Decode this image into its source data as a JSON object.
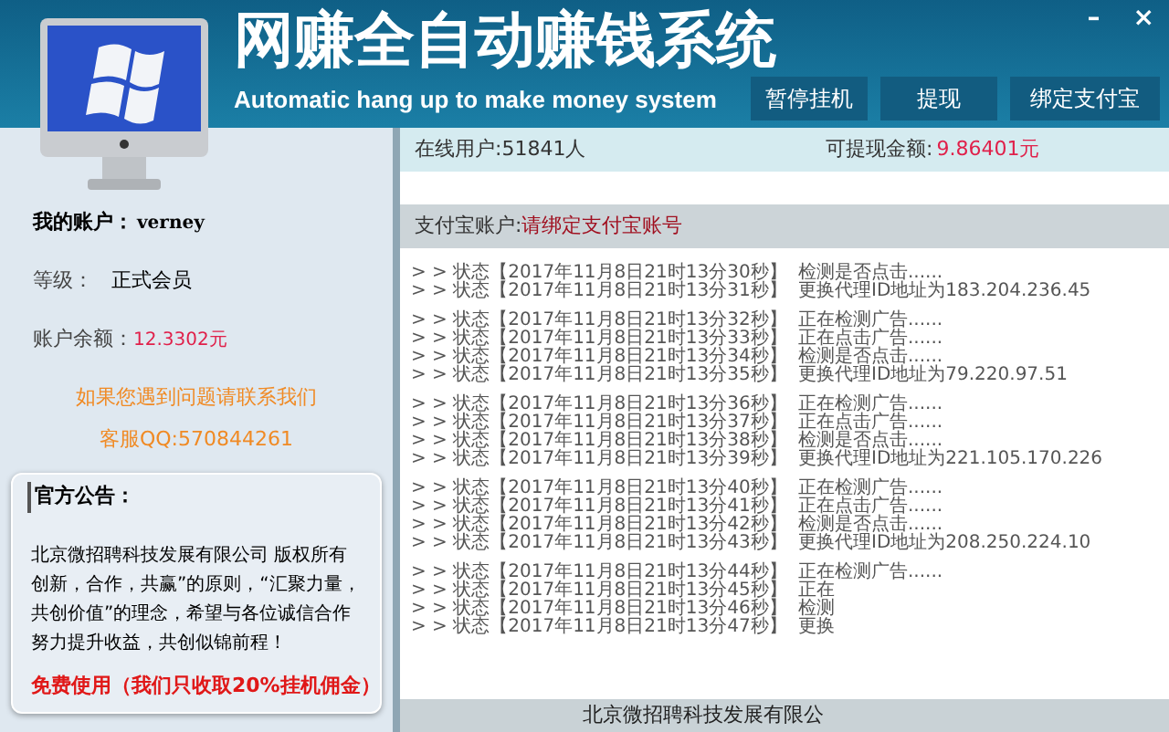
{
  "window": {
    "title": "网赚全自动赚钱系统",
    "subtitle": "Automatic hang up to make money system",
    "controls": [
      "–",
      "×"
    ]
  },
  "toolbar": {
    "buttons": [
      "暂停挂机",
      "提现",
      "绑定支付宝"
    ]
  },
  "account": {
    "username_label": "我的账户：",
    "username": "verney",
    "level_label": "等级：",
    "level": "正式会员",
    "balance_label": "账户余额：",
    "balance": "12.3302元",
    "contact": [
      "如果您遇到问题请联系我们",
      "客服QQ:570844261"
    ]
  },
  "notice": {
    "title": "官方公告：",
    "lines": [
      "北京微招聘科技发展有限公司 版权所有",
      "创新，合作，共赢”的原则，“汇聚力量，",
      "共创价值”的理念，希望与各位诚信合作",
      "努力提升收益，共创似锦前程！"
    ],
    "highlight": "免费使用（我们只收取20%挂机佣金）"
  },
  "stats": {
    "online_label": "在线用户:",
    "online": "51841人",
    "withdrawable_label": "可提现金额:",
    "withdrawable": "9.86401元"
  },
  "alipay": {
    "label": "支付宝账户:",
    "value": "请绑定支付宝账号"
  },
  "log_groups": [
    [
      {
        "prefix": "> > 状态【2017年11月8日21时13分30秒】",
        "message": "检测是否点击......"
      },
      {
        "prefix": "> > 状态【2017年11月8日21时13分31秒】",
        "message": "更换代理ID地址为183.204.236.45"
      }
    ],
    [
      {
        "prefix": "> > 状态【2017年11月8日21时13分32秒】",
        "message": "正在检测广告......"
      },
      {
        "prefix": "> > 状态【2017年11月8日21时13分33秒】",
        "message": "正在点击广告......"
      },
      {
        "prefix": "> > 状态【2017年11月8日21时13分34秒】",
        "message": "检测是否点击......"
      },
      {
        "prefix": "> > 状态【2017年11月8日21时13分35秒】",
        "message": "更换代理ID地址为79.220.97.51"
      }
    ],
    [
      {
        "prefix": "> > 状态【2017年11月8日21时13分36秒】",
        "message": "正在检测广告......"
      },
      {
        "prefix": "> > 状态【2017年11月8日21时13分37秒】",
        "message": "正在点击广告......"
      },
      {
        "prefix": "> > 状态【2017年11月8日21时13分38秒】",
        "message": "检测是否点击......"
      },
      {
        "prefix": "> > 状态【2017年11月8日21时13分39秒】",
        "message": "更换代理ID地址为221.105.170.226"
      }
    ],
    [
      {
        "prefix": "> > 状态【2017年11月8日21时13分40秒】",
        "message": "正在检测广告......"
      },
      {
        "prefix": "> > 状态【2017年11月8日21时13分41秒】",
        "message": "正在点击广告......"
      },
      {
        "prefix": "> > 状态【2017年11月8日21时13分42秒】",
        "message": "检测是否点击......"
      },
      {
        "prefix": "> > 状态【2017年11月8日21时13分43秒】",
        "message": "更换代理ID地址为208.250.224.10"
      }
    ],
    [
      {
        "prefix": "> > 状态【2017年11月8日21时13分44秒】",
        "message": "正在检测广告......"
      },
      {
        "prefix": "> > 状态【2017年11月8日21时13分45秒】",
        "message": "正在"
      },
      {
        "prefix": "> > 状态【2017年11月8日21时13分46秒】",
        "message": "检测"
      },
      {
        "prefix": "> > 状态【2017年11月8日21时13分47秒】",
        "message": "更换"
      }
    ]
  ],
  "footer": "北京微招聘科技发展有限公"
}
